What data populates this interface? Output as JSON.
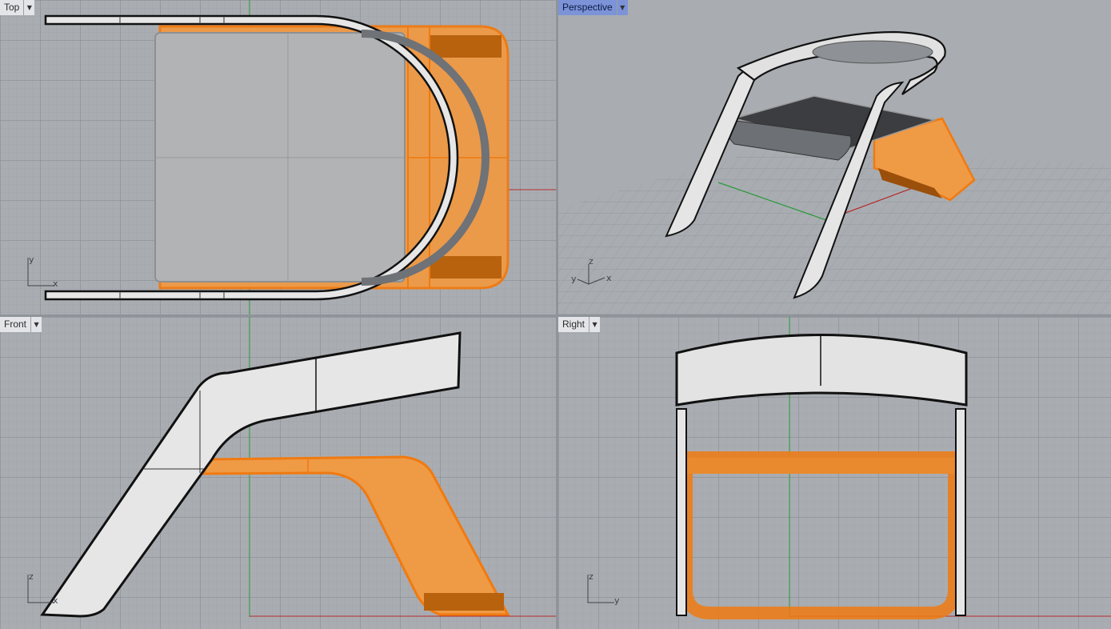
{
  "viewports": {
    "top": {
      "label": "Top"
    },
    "perspective": {
      "label": "Perspective",
      "active": true
    },
    "front": {
      "label": "Front"
    },
    "right": {
      "label": "Right"
    }
  },
  "axes": {
    "top": [
      "y",
      "x"
    ],
    "perspective": [
      "z",
      "y",
      "x"
    ],
    "front": [
      "z",
      "x"
    ],
    "right": [
      "z",
      "y"
    ]
  },
  "icons": {
    "viewport_menu": "chevron-down-icon"
  },
  "colors": {
    "selection": "#f08a20",
    "x_axis": "#b52a2a",
    "y_axis": "#2a9a3a"
  }
}
